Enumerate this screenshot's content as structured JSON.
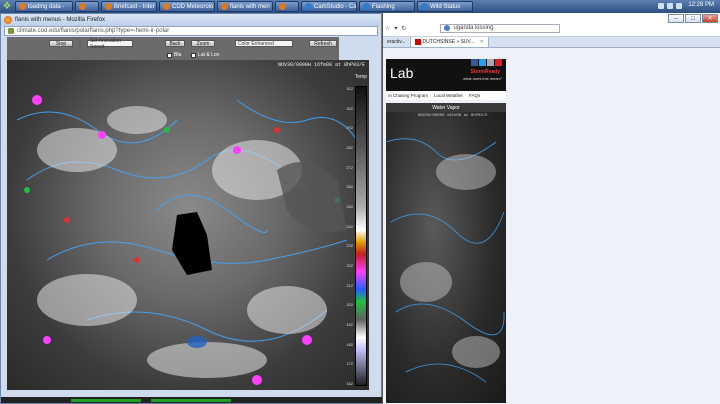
{
  "taskbar": {
    "items": [
      {
        "label": "loading data -",
        "icon": "firefox-icon"
      },
      {
        "label": "",
        "icon": "firefox-icon"
      },
      {
        "label": "Briefcast - Inter",
        "icon": "firefox-icon"
      },
      {
        "label": "CDD Meteorolo",
        "icon": "firefox-icon"
      },
      {
        "label": "flanis with men",
        "icon": "firefox-icon"
      },
      {
        "label": "",
        "icon": "firefox-icon"
      },
      {
        "label": "CamStudio - Ca",
        "icon": "camstudio-icon"
      },
      {
        "label": "Flashing",
        "icon": "folder-icon"
      },
      {
        "label": "Wild Status",
        "icon": "window-icon"
      }
    ],
    "clock": "12:28 PM"
  },
  "left_window": {
    "title": "flanis with menus - Mozilla Firefox",
    "url": "climate.cod.edu/flanis/polarflanis.php?type=-hemi-ir-polar",
    "toolbar": {
      "stop_label": "Stop",
      "animation_select": "Set Animation Speed",
      "back_label": "Back",
      "zoom_label": "Zoom",
      "color_select": "Color Enhanced",
      "refresh_label": "Refresh",
      "checkbox_1": "Bla",
      "checkbox_2": "Lat & Lon"
    },
    "image_header": "NOV30/0900H 16fe08 at 8hP03/E",
    "scale_title": "Temp",
    "scale_labels": [
      "312",
      "302",
      "292",
      "282",
      "272",
      "262",
      "252",
      "242",
      "232",
      "222",
      "212",
      "202",
      "192",
      "182",
      "172",
      "162"
    ]
  },
  "right_window": {
    "window_controls": {
      "minimize": "–",
      "maximize": "□",
      "close": "✕"
    },
    "search_value": "uganda kissing",
    "tabs": [
      {
        "label": "eractiv...",
        "active": false
      },
      {
        "label": "DUTCHSINSE » SUV...",
        "active": true
      }
    ],
    "site": {
      "logo_text": "Lab",
      "brand": "StormReady",
      "brand_sub": "what does this mean?",
      "nav": [
        "m Chasing Program",
        "Local Weather",
        "FAQs"
      ],
      "panel_title": "Water Vapor",
      "panel_header": "NOV30/0900H 16fe08 at 8hP03/E"
    }
  }
}
